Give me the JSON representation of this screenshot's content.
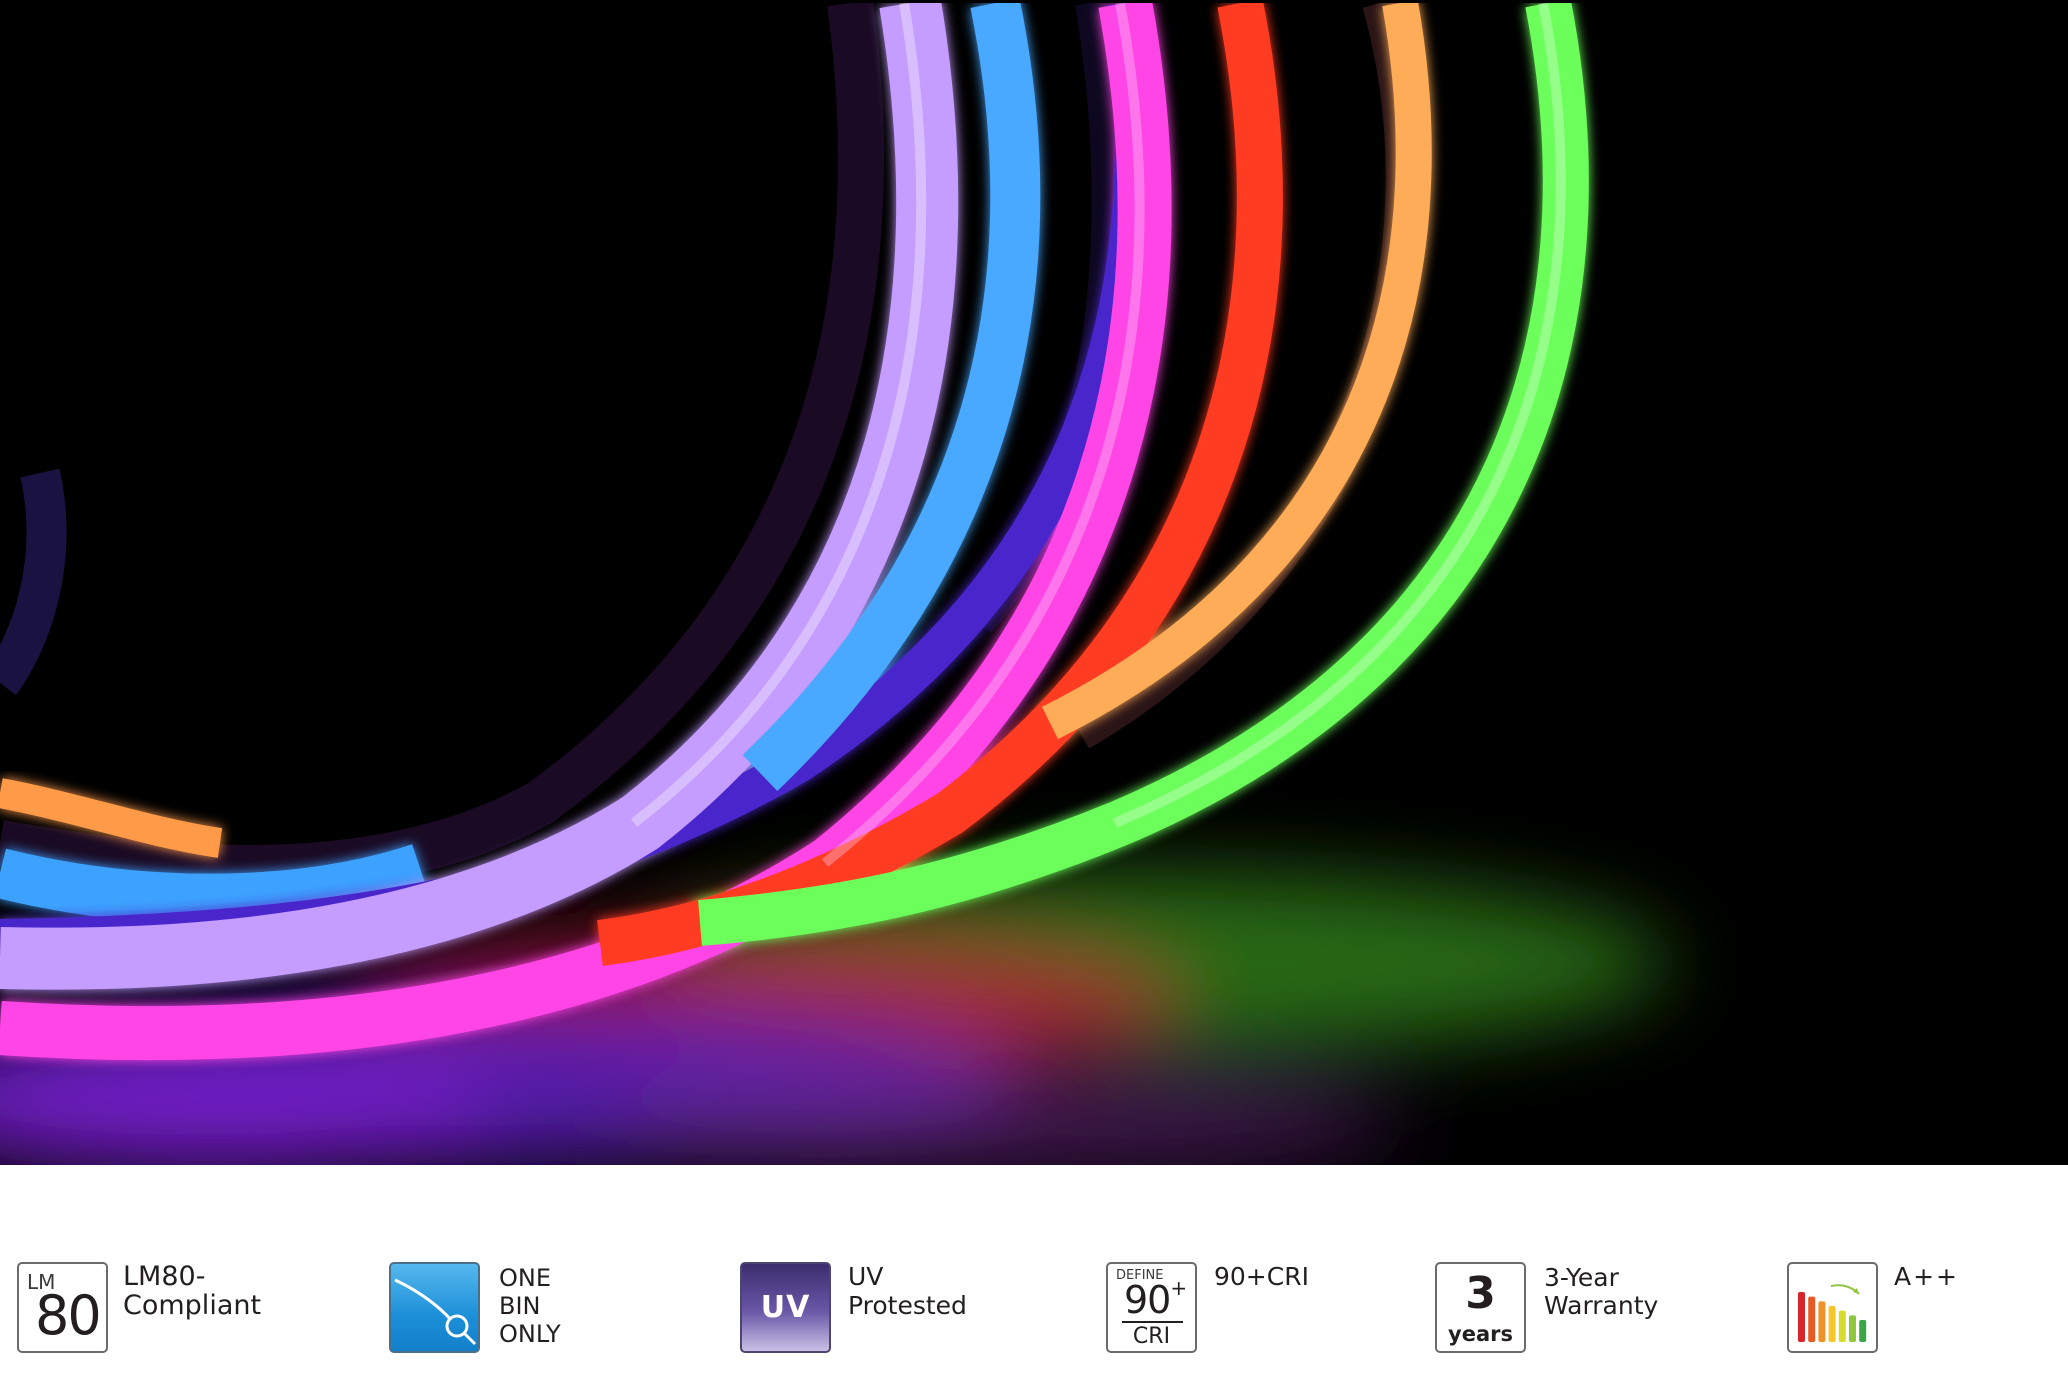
{
  "photo": {
    "subject": "neon-flex-light-strips",
    "colors": {
      "background": "#000000",
      "lavender": "#c79bff",
      "sky_blue": "#49a6ff",
      "indigo": "#5a2fe0",
      "magenta": "#ff3fe0",
      "red": "#ff3a25",
      "amber": "#ffab55",
      "green": "#6bff5a"
    }
  },
  "features": [
    {
      "icon": "lm80-icon",
      "badge_small": "LM",
      "badge_big": "80",
      "label_lines": [
        "LM80-",
        "Compliant"
      ]
    },
    {
      "icon": "one-bin-icon",
      "label_lines": [
        "ONE",
        "BIN",
        "ONLY"
      ],
      "badge_color": "#1c8fd8"
    },
    {
      "icon": "uv-icon",
      "badge_text": "UV",
      "label_lines": [
        "UV",
        "Protested"
      ],
      "badge_color": "#5a4a96"
    },
    {
      "icon": "cri-icon",
      "badge_small": "DEFINE",
      "badge_big": "90",
      "badge_sup": "+",
      "badge_bottom": "CRI",
      "label_lines": [
        "90+CRI"
      ]
    },
    {
      "icon": "warranty-icon",
      "badge_big": "3",
      "badge_bottom": "years",
      "label_lines": [
        "3-Year",
        "Warranty"
      ]
    },
    {
      "icon": "energy-rating-icon",
      "label_lines": [
        "A++"
      ],
      "bar_colors": [
        "#d7262b",
        "#e65a25",
        "#f0922a",
        "#f7c72a",
        "#d7dc2e",
        "#8fc63f",
        "#3aa648"
      ]
    }
  ]
}
